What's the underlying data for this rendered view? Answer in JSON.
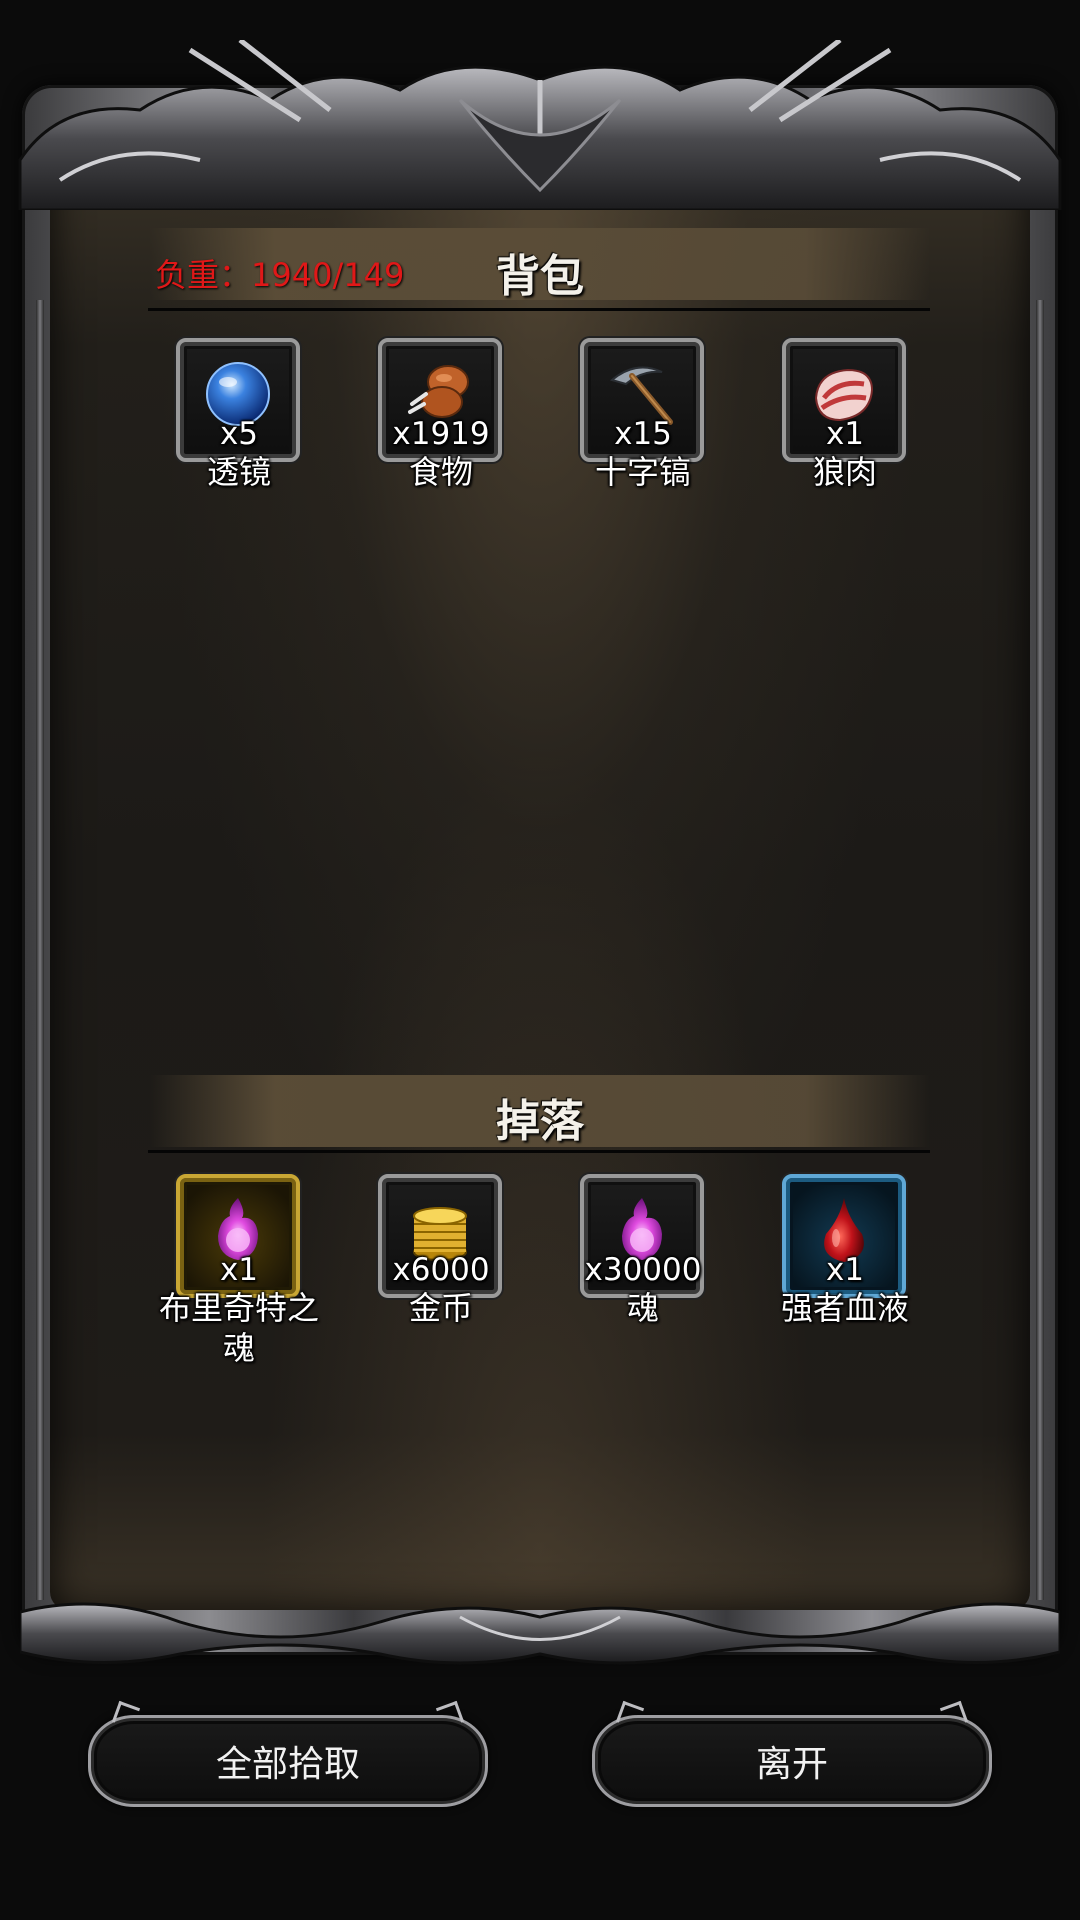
{
  "backpack": {
    "title": "背包",
    "weight_label": "负重：1940/149",
    "items": [
      {
        "name": "透镜",
        "qty": "x5",
        "icon": "lens-orb-icon"
      },
      {
        "name": "食物",
        "qty": "x1919",
        "icon": "food-drumstick-icon"
      },
      {
        "name": "十字镐",
        "qty": "x15",
        "icon": "pickaxe-icon"
      },
      {
        "name": "狼肉",
        "qty": "x1",
        "icon": "wolf-meat-icon"
      }
    ]
  },
  "loot": {
    "title": "掉落",
    "items": [
      {
        "name": "布里奇特之魂",
        "qty": "x1",
        "icon": "purple-soul-icon",
        "rarity": "gold"
      },
      {
        "name": "金币",
        "qty": "x6000",
        "icon": "gold-coins-icon",
        "rarity": "normal"
      },
      {
        "name": "魂",
        "qty": "x30000",
        "icon": "purple-soul-icon",
        "rarity": "normal"
      },
      {
        "name": "强者血液",
        "qty": "x1",
        "icon": "blood-drop-icon",
        "rarity": "blue"
      }
    ]
  },
  "buttons": {
    "pickup_all": "全部拾取",
    "leave": "离开"
  },
  "colors": {
    "weight_text": "#e01818",
    "rare_gold_border": "#c9a734",
    "rare_blue_border": "#5fa8d6"
  }
}
